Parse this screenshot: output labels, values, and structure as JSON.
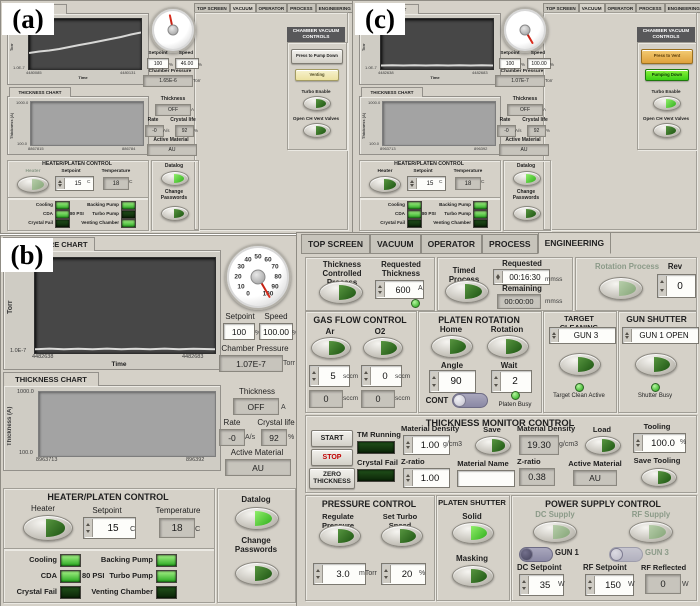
{
  "fig": {
    "a": "(a)",
    "b": "(b)",
    "c": "(c)"
  },
  "tabs": {
    "items": [
      "TOP SCREEN",
      "VACUUM",
      "OPERATOR",
      "PROCESS",
      "ENGINEERING"
    ]
  },
  "vac": {
    "thickness_chart_tab": "THICKNESS CHART",
    "setpoint": "Setpoint",
    "speed": "Speed",
    "chamber_pressure": "Chamber Pressure",
    "thickness": "Thickness",
    "rate": "Rate",
    "crystal_life": "Crystal life",
    "active_material": "Active Material",
    "heater_platen": "HEATER/PLATEN CONTROL",
    "heater": "Heater",
    "temperature": "Temperature",
    "cooling": "Cooling",
    "cda": "CDA",
    "cda_psi": "80 PSI",
    "crystal_fail": "Crystal Fail",
    "backing_pump": "Backing Pump",
    "turbo_pump": "Turbo Pump",
    "venting_chamber": "Venting Chamber",
    "datalog": "Datalog",
    "change_passwords": "Change Passwords",
    "cvc_title": "CHAMBER VACUUM CONTROLS",
    "turbo_enable": "Turbo Enable",
    "open_vent": "Open CH Vent Valves",
    "time_axis": "Time",
    "torr_axis": "Torr",
    "thickness_axis": "Thickness (A)",
    "dial": [
      "0",
      "10",
      "20",
      "30",
      "40",
      "50",
      "60",
      "70",
      "80",
      "90",
      "100"
    ],
    "u": {
      "pct": "%",
      "c": "C",
      "a": "A",
      "aps": "A/s",
      "torr": "Torr"
    }
  },
  "panel_a": {
    "pressure_tab": "SURE CHART",
    "setpoint": "100",
    "speed": "46.00",
    "pressure": "1.65E-6",
    "thickness": "OFF",
    "rate": "-0",
    "crystal_life": "92",
    "material": "AU",
    "heater_setpoint": "15",
    "temperature": "18",
    "cvc_top": "Press to Pump Down",
    "cvc_bottom": "Venting",
    "chart": {
      "y1": "1.0E-6",
      "y0": "1.0E-7",
      "x0": "4480085",
      "x1": "4480131",
      "ty1": "1000.0",
      "ty0": "100.0",
      "tx0": "8867815",
      "tx1": "886784"
    }
  },
  "panel_b": {
    "pressure_tab": "R PRESSURE CHART",
    "setpoint": "100",
    "speed": "100.00",
    "pressure": "1.07E-7",
    "thickness": "OFF",
    "rate": "-0",
    "crystal_life": "92",
    "material": "AU",
    "heater_setpoint": "15",
    "temperature": "18",
    "chart": {
      "y0": "1.0E-7",
      "x0": "4482638",
      "x1": "4482683",
      "ty1": "1000.0",
      "ty0": "100.0",
      "tx0": "8963713",
      "tx1": "896392"
    }
  },
  "panel_c": {
    "pressure_tab": "SSURE CHART",
    "setpoint": "100",
    "speed": "100.00",
    "pressure": "1.07E-7",
    "thickness": "OFF",
    "rate": "-0",
    "crystal_life": "92",
    "material": "AU",
    "heater_setpoint": "15",
    "temperature": "18",
    "cvc_top": "Press to Vent",
    "cvc_bottom": "Pumping Down",
    "chart": {
      "y0": "1.0E-7",
      "x0": "4482638",
      "x1": "4482683",
      "ty1": "1000.0",
      "ty0": "100.0",
      "tx0": "8963713",
      "tx1": "896392"
    }
  },
  "engineering": {
    "g1_btn": "Thickness Controlled Process",
    "g1_req": "Requested Thickness",
    "g1_value": "600",
    "u_a": "A",
    "g2_btn": "Timed Process",
    "g2_req": "Requested Time",
    "g2_req_value": "00:16:30",
    "g2_rem": "Remaining Time",
    "g2_rem_value": "00:00:00",
    "u_mmss": "mmss",
    "g3_btn": "Rotation Process",
    "g3_rev": "Rev",
    "g3_rev_value": "0",
    "gas": {
      "title": "GAS FLOW CONTROL",
      "ar": "Ar",
      "o2": "O2",
      "ar_set": "5",
      "o2_set": "0",
      "ar_act": "0",
      "o2_act": "0",
      "u": "sccm"
    },
    "platen": {
      "title": "PLATEN ROTATION",
      "home": "Home",
      "rotation": "Rotation",
      "angle": "Angle",
      "angle_value": "90",
      "wait": "Wait",
      "wait_value": "2",
      "cont": "CONT",
      "busy": "Platen Busy"
    },
    "target": {
      "title": "TARGET CLEANING",
      "gun": "GUN 3",
      "active": "Target Clean Active"
    },
    "shutter": {
      "title": "GUN SHUTTER",
      "gun": "GUN 1 OPEN",
      "busy": "Shutter Busy"
    },
    "tmc": {
      "title": "THICKNESS MONITOR CONTROL",
      "start": "START",
      "stop": "STOP",
      "zero": "ZERO THICKNESS",
      "tm_running": "TM Running",
      "crystal_fail": "Crystal Fail",
      "density_label": "Material Density",
      "density_set": "1.00",
      "zratio_label": "Z-ratio",
      "zratio_set": "1.00",
      "save": "Save",
      "material_name_label": "Material Name",
      "material_name": "",
      "density_act": "19.30",
      "zratio_act": "0.38",
      "load": "Load",
      "active_material_label": "Active Material",
      "active_material": "AU",
      "tooling_label": "Tooling",
      "tooling": "100.0",
      "save_tooling": "Save Tooling",
      "u_gcm3": "g/cm3",
      "u_pct": "%"
    },
    "pressure": {
      "title": "PRESSURE CONTROL",
      "regulate": "Regulate Pressure",
      "turbo": "Set Turbo Speed",
      "p_value": "3.0",
      "u_mtorr": "mTorr",
      "speed_value": "20",
      "u_pct": "%"
    },
    "pshutter": {
      "title": "PLATEN SHUTTER",
      "solid": "Solid",
      "masking": "Masking"
    },
    "power": {
      "title": "POWER SUPPLY CONTROL",
      "dc": "DC Supply",
      "rf": "RF Supply",
      "gun1": "GUN 1",
      "gun3": "GUN 3",
      "dc_set_label": "DC Setpoint",
      "dc_set": "35",
      "rf_set_label": "RF Setpoint",
      "rf_set": "150",
      "rf_ref_label": "RF Reflected",
      "rf_ref": "0",
      "u_w": "W"
    }
  },
  "chart_data": [
    {
      "panel": "a",
      "type": "line",
      "title": "Chamber Pressure Chart",
      "xlabel": "Time",
      "ylabel": "Torr",
      "yscale": "log",
      "yticks": [
        "1.0E-6",
        "1.0E-7"
      ],
      "x_range": [
        4480085,
        4480131
      ],
      "series": [
        {
          "name": "chamber_pressure",
          "values_approx": [
            2.2e-07,
            3.5e-07,
            5.5e-07,
            8e-07,
            1.2e-06,
            1.65e-06
          ]
        }
      ],
      "note": "pressure rising while venting"
    },
    {
      "panel": "b_and_c",
      "type": "line",
      "title": "Chamber Pressure Chart",
      "xlabel": "Time",
      "ylabel": "Torr",
      "yscale": "log",
      "yticks": [
        "1.0E-7"
      ],
      "x_range": [
        4482638,
        4482683
      ],
      "series": [
        {
          "name": "chamber_pressure",
          "values_approx": [
            1.07e-07,
            1.07e-07,
            1.07e-07,
            1.07e-07
          ]
        }
      ],
      "note": "flat baseline at 1.07E-7 Torr"
    },
    {
      "panel": "thickness_all",
      "type": "line",
      "title": "Thickness Chart",
      "xlabel": "Time",
      "ylabel": "Thickness (A)",
      "ylim": [
        100.0,
        1000.0
      ],
      "x_range": [
        8963713,
        8963920
      ],
      "series": [],
      "note": "no trace, monitor off"
    }
  ],
  "accent_colors": {
    "led_on": "#27a81f",
    "led_off": "#20511a",
    "amber_button": "#dfa13c",
    "pumping_green": "#3bd014",
    "venting_yellow": "#ece1a0",
    "needle_red": "#d02818"
  }
}
